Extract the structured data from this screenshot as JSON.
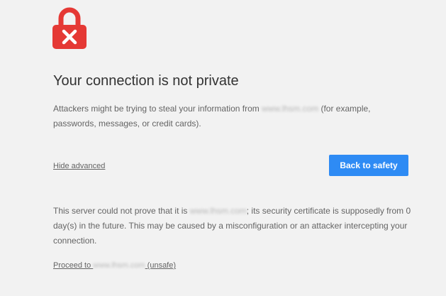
{
  "icon": "lock-error-icon",
  "colors": {
    "lock_red": "#e53935",
    "button_blue": "#2e8bf4",
    "background": "#f2f2f2",
    "title": "#333333",
    "body_text": "#646464"
  },
  "title": "Your connection is not private",
  "intro": {
    "before": "Attackers might be trying to steal your information from ",
    "domain": "www.lhsm.com",
    "after": " (for example, passwords, messages, or credit cards)."
  },
  "hide_advanced_label": "Hide advanced",
  "back_button_label": "Back to safety",
  "details": {
    "before": "This server could not prove that it is ",
    "domain": "www.lhsm.com",
    "after": "; its security certificate is supposedly from 0 day(s) in the future. This may be caused by a misconfiguration or an attacker intercepting your connection."
  },
  "proceed": {
    "before": "Proceed to ",
    "domain": "www.lhsm.com",
    "after": " (unsafe)"
  }
}
